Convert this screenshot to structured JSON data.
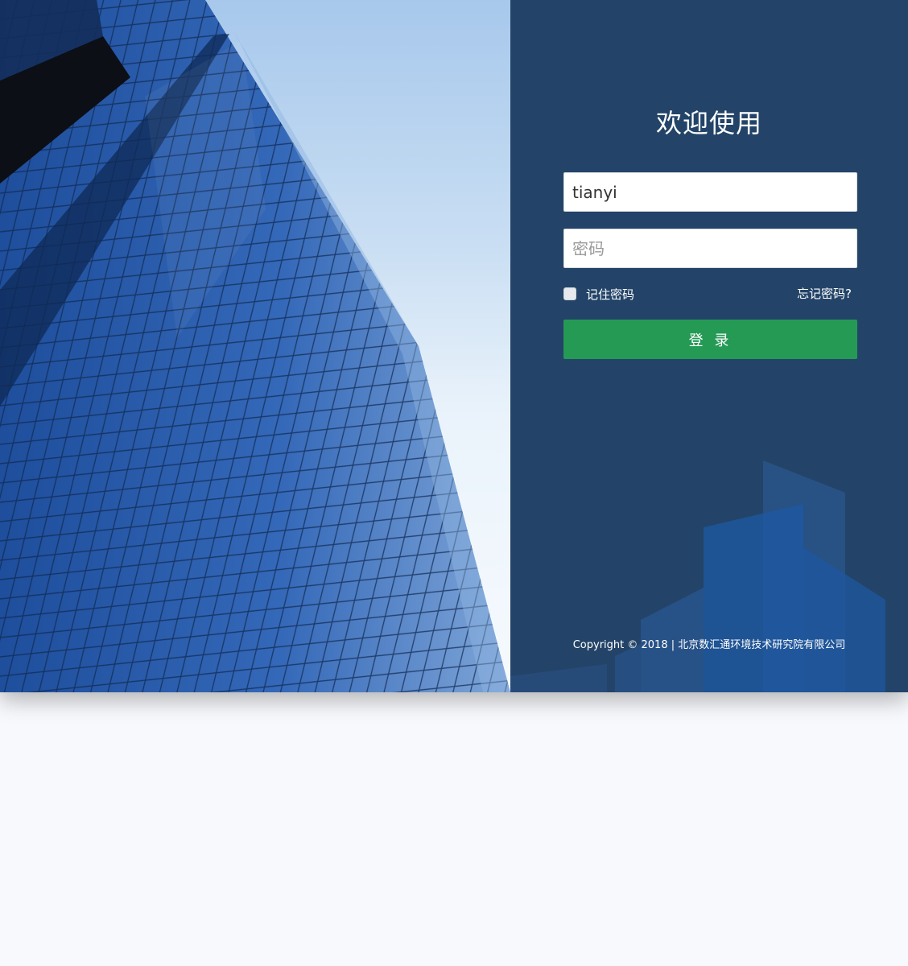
{
  "login": {
    "title": "欢迎使用",
    "username_value": "tianyi",
    "password_placeholder": "密码",
    "remember_label": "记住密码",
    "forgot_label": "忘记密码?",
    "submit_label": "登 录",
    "copyright": "Copyright © 2018 | 北京数汇通环境技术研究院有限公司"
  },
  "colors": {
    "panel_bg": "#234468",
    "submit_bg": "#249a55",
    "page_bg": "#f7f9fd"
  },
  "icons": {
    "building_photo": "glass-skyscraper-image",
    "skyline": "city-skyline-decoration"
  }
}
